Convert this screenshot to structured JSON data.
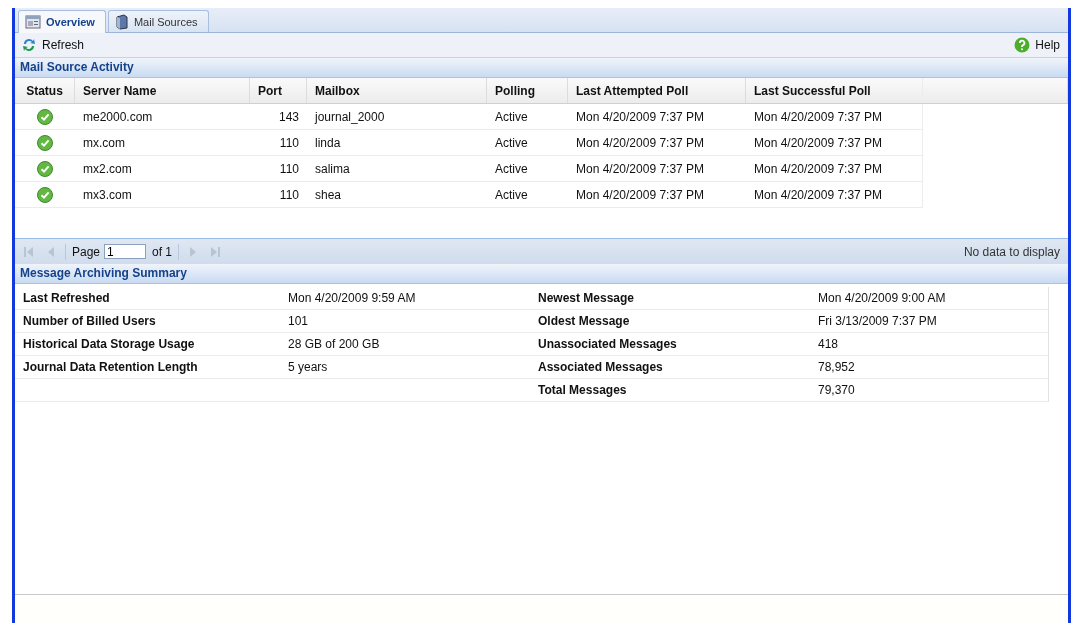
{
  "tabs": [
    {
      "label": "Overview",
      "kind": "overview",
      "selected": true
    },
    {
      "label": "Mail Sources",
      "kind": "server",
      "selected": false
    }
  ],
  "toolbar": {
    "refresh": "Refresh",
    "help": "Help"
  },
  "activity": {
    "title": "Mail Source Activity",
    "columns": [
      "Status",
      "Server Name",
      "Port",
      "Mailbox",
      "Polling",
      "Last Attempted Poll",
      "Last Successful Poll"
    ],
    "rows": [
      {
        "kind": "ok",
        "server": "me2000.com",
        "port": "143",
        "mailbox": "journal_2000",
        "polling": "Active",
        "attempted": "Mon 4/20/2009 7:37 PM",
        "successful": "Mon 4/20/2009 7:37 PM"
      },
      {
        "kind": "ok",
        "server": "mx.com",
        "port": "110",
        "mailbox": "linda",
        "polling": "Active",
        "attempted": "Mon 4/20/2009 7:37 PM",
        "successful": "Mon 4/20/2009 7:37 PM"
      },
      {
        "kind": "ok",
        "server": "mx2.com",
        "port": "110",
        "mailbox": "salima",
        "polling": "Active",
        "attempted": "Mon 4/20/2009 7:37 PM",
        "successful": "Mon 4/20/2009 7:37 PM"
      },
      {
        "kind": "ok",
        "server": "mx3.com",
        "port": "110",
        "mailbox": "shea",
        "polling": "Active",
        "attempted": "Mon 4/20/2009 7:37 PM",
        "successful": "Mon 4/20/2009 7:37 PM"
      }
    ],
    "pager": {
      "page_label": "Page",
      "page": "1",
      "of": "of 1",
      "status": "No data to display"
    }
  },
  "summary": {
    "title": "Message Archiving Summary",
    "rows": [
      {
        "left_label": "Last Refreshed",
        "left_value": "Mon 4/20/2009 9:59 AM",
        "right_label": "Newest Message",
        "right_value": "Mon 4/20/2009 9:00 AM"
      },
      {
        "left_label": "Number of Billed Users",
        "left_value": "101",
        "right_label": "Oldest Message",
        "right_value": "Fri 3/13/2009 7:37 PM"
      },
      {
        "left_label": "Historical Data Storage Usage",
        "left_value": "28 GB of 200 GB",
        "right_label": "Unassociated Messages",
        "right_value": "418"
      },
      {
        "left_label": "Journal Data Retention Length",
        "left_value": "5 years",
        "right_label": "Associated Messages",
        "right_value": "78,952"
      },
      {
        "right_label": "Total Messages",
        "right_value": "79,370"
      }
    ]
  }
}
